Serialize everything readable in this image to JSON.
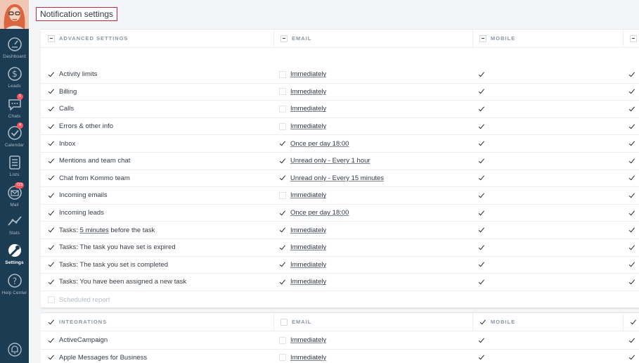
{
  "page_title": "Notification settings",
  "nav": [
    {
      "label": "Dashboard",
      "icon": "dashboard-icon"
    },
    {
      "label": "Leads",
      "icon": "dollar-icon"
    },
    {
      "label": "Chats",
      "icon": "chat-icon",
      "badge": "5"
    },
    {
      "label": "Calendar",
      "icon": "calendar-check-icon",
      "badge": "4"
    },
    {
      "label": "Lists",
      "icon": "lists-icon"
    },
    {
      "label": "Mail",
      "icon": "mail-icon",
      "badge": "723"
    },
    {
      "label": "Stats",
      "icon": "stats-icon"
    },
    {
      "label": "Settings",
      "icon": "settings-icon",
      "active": true
    },
    {
      "label": "Help Center",
      "icon": "help-icon"
    }
  ],
  "section1": {
    "headers": {
      "settings": "ADVANCED SETTINGS",
      "email": "EMAIL",
      "mobile": "MOBILE"
    },
    "rows": [
      {
        "label": "Activity limits",
        "email_checked": false,
        "email_value": "Immediately"
      },
      {
        "label": "Billing",
        "email_checked": false,
        "email_value": "Immediately"
      },
      {
        "label": "Calls",
        "email_checked": false,
        "email_value": "Immediately"
      },
      {
        "label": "Errors & other info",
        "email_checked": false,
        "email_value": "Immediately"
      },
      {
        "label": "Inbox",
        "email_checked": true,
        "email_value": "Once per day 18:00"
      },
      {
        "label": "Mentions and team chat",
        "email_checked": true,
        "email_value": "Unread only - Every 1 hour"
      },
      {
        "label": "Chat from Kommo team",
        "email_checked": true,
        "email_value": "Unread only - Every 15 minutes"
      },
      {
        "label": "Incoming emails",
        "email_checked": false,
        "email_value": "Immediately"
      },
      {
        "label": "Incoming leads",
        "email_checked": true,
        "email_value": "Once per day 18:00"
      },
      {
        "label_prefix": "Tasks: ",
        "label_link": "5 minutes",
        "label_suffix": " before the task",
        "email_checked": true,
        "email_value": "Immediately"
      },
      {
        "label": "Tasks: The task you have set is expired",
        "email_checked": true,
        "email_value": "Immediately"
      },
      {
        "label": "Tasks: The task you set is completed",
        "email_checked": true,
        "email_value": "Immediately"
      },
      {
        "label": "Tasks: You have been assigned a new task",
        "email_checked": true,
        "email_value": "Immediately"
      }
    ],
    "disabled_row": "Scheduled report"
  },
  "section2": {
    "headers": {
      "settings": "INTEGRATIONS",
      "email": "EMAIL",
      "mobile": "MOBILE"
    },
    "rows": [
      {
        "label": "ActiveCampaign",
        "email_value": "Immediately"
      },
      {
        "label": "Apple Messages for Business",
        "email_value": "Immediately"
      }
    ]
  }
}
